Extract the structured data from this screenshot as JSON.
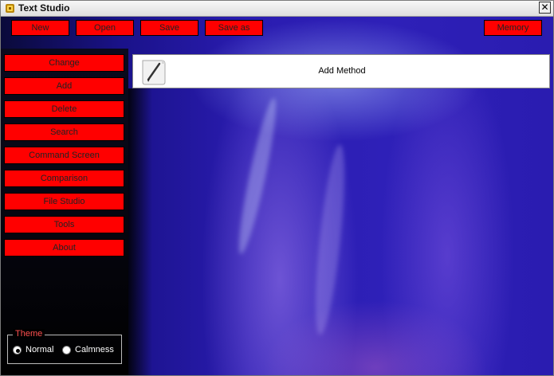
{
  "window": {
    "title": "Text Studio",
    "close_glyph": "✕"
  },
  "toolbar": {
    "new": "New",
    "open": "Open",
    "save": "Save",
    "save_as": "Save as",
    "memory": "Memory"
  },
  "sidebar": {
    "items": [
      {
        "label": "Change"
      },
      {
        "label": "Add"
      },
      {
        "label": "Delete"
      },
      {
        "label": "Search"
      },
      {
        "label": "Command Screen"
      },
      {
        "label": "Comparison"
      },
      {
        "label": "File Studio"
      },
      {
        "label": "Tools"
      },
      {
        "label": "About"
      }
    ]
  },
  "header": {
    "title": "Add Method",
    "icon": "pencil-icon"
  },
  "theme": {
    "legend": "Theme",
    "options": [
      {
        "label": "Normal",
        "selected": true
      },
      {
        "label": "Calmness",
        "selected": false
      }
    ]
  },
  "colors": {
    "button_red": "#ff0000",
    "legend_red": "#ff5050",
    "background_blue": "#2a1cb0"
  }
}
